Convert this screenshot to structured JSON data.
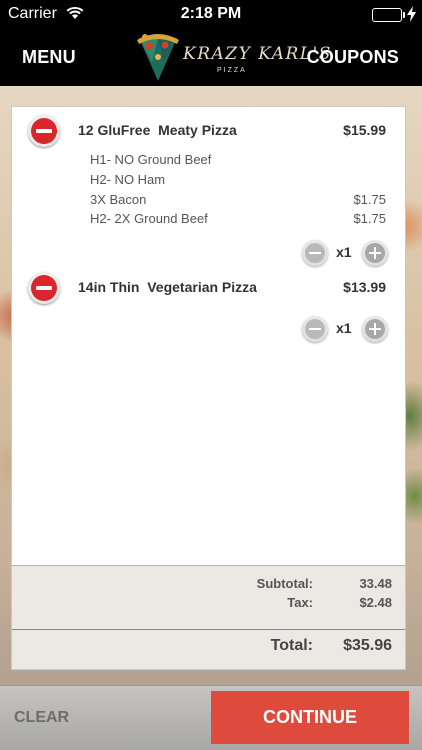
{
  "status_bar": {
    "carrier": "Carrier",
    "time": "2:18 PM",
    "battery_level": 1.0,
    "battery_color": "#4cd964"
  },
  "nav": {
    "menu_label": "MENU",
    "coupons_label": "COUPONS",
    "logo_text": "KRAZY KARL'S",
    "logo_subtext": "PIZZA"
  },
  "cart": {
    "items": [
      {
        "name": "12 GluFree  Meaty Pizza",
        "price": "$15.99",
        "modifiers": [
          {
            "name": "H1- NO Ground Beef",
            "price": ""
          },
          {
            "name": "H2- NO Ham",
            "price": ""
          },
          {
            "name": "3X Bacon",
            "price": "$1.75"
          },
          {
            "name": "H2- 2X Ground Beef",
            "price": "$1.75"
          }
        ],
        "quantity": "x1"
      },
      {
        "name": "14in Thin  Vegetarian Pizza",
        "price": "$13.99",
        "modifiers": [],
        "quantity": "x1"
      }
    ],
    "summary": {
      "subtotal_label": "Subtotal:",
      "subtotal_value": "33.48",
      "tax_label": "Tax:",
      "tax_value": "$2.48",
      "total_label": "Total:",
      "total_value": "$35.96"
    }
  },
  "footer": {
    "clear_label": "CLEAR",
    "continue_label": "CONTINUE",
    "continue_color": "#de4a3c"
  }
}
